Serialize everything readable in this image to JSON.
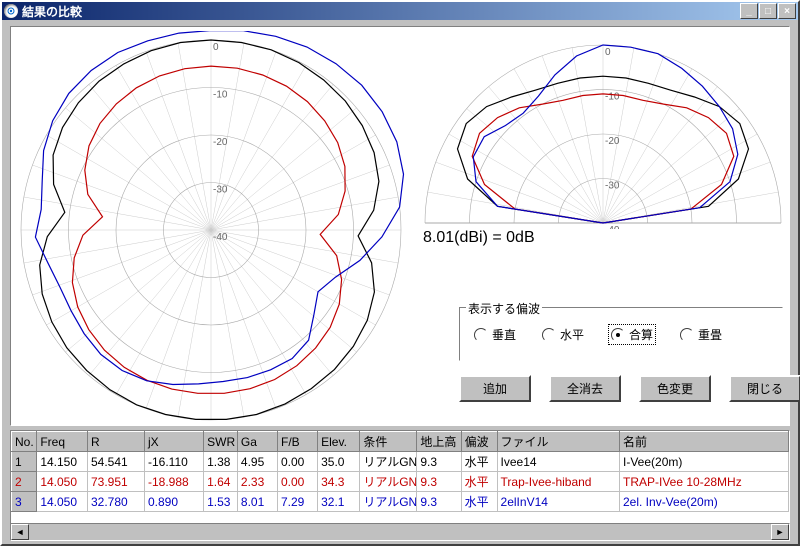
{
  "window": {
    "title": "結果の比較"
  },
  "chart_data": [
    {
      "type": "polar-azimuth",
      "rings": [
        0,
        -10,
        -20,
        -30,
        -40
      ],
      "angles_deg": {
        "start": 0,
        "end": 360,
        "step": 10
      },
      "zero_at": "top",
      "series": [
        {
          "name": "Ivee14",
          "color": "#000000",
          "r": [
            0,
            0,
            0,
            -0.2,
            -0.5,
            -0.8,
            -1.3,
            -2,
            -3.2,
            -5.5,
            -9,
            -5.5,
            -3.2,
            -2,
            -1.3,
            -0.8,
            -0.5,
            -0.2,
            0,
            0,
            0,
            0,
            0,
            -0.2,
            -0.5,
            -0.8,
            -1.3,
            -2,
            -3.2,
            -5.5,
            -9,
            -5.5,
            -3.2,
            -2,
            -1.3,
            -0.8,
            -0.5,
            -0.2,
            0,
            0
          ]
        },
        {
          "name": "Trap-Ivee-hiband",
          "color": "#c00000",
          "r": [
            -5.5,
            -5.5,
            -5.6,
            -5.8,
            -6.2,
            -6.8,
            -7.6,
            -8.8,
            -10.6,
            -13,
            -17,
            -13,
            -10.6,
            -8.8,
            -7.6,
            -6.8,
            -6.2,
            -5.8,
            -5.6,
            -5.5,
            -5.5,
            -5.5,
            -5.6,
            -5.8,
            -6.2,
            -6.8,
            -7.6,
            -8.8,
            -10.6,
            -13,
            -17,
            -13,
            -10.6,
            -8.8,
            -7.6,
            -6.8,
            -6.2,
            -5.8,
            -5.6,
            -5.5
          ]
        },
        {
          "name": "2elInV14",
          "color": "#0000c0",
          "r": [
            2,
            2.5,
            3,
            3.5,
            3.8,
            4,
            3.8,
            3.3,
            2.2,
            0,
            -4,
            -8,
            -12,
            -14,
            -12,
            -9,
            -8,
            -8,
            -8,
            -8,
            -7.5,
            -6.5,
            -5.5,
            -5,
            -5,
            -5.5,
            -6,
            -6,
            -5,
            -3,
            -4,
            -3,
            -1,
            0.5,
            1.5,
            2,
            2.2,
            2,
            2,
            2
          ]
        }
      ]
    },
    {
      "type": "polar-elevation",
      "rings": [
        0,
        -10,
        -20,
        -30,
        -40
      ],
      "angles_deg": {
        "start": 0,
        "end": 180,
        "step": 10
      },
      "zero_at": "top",
      "series": [
        {
          "name": "Ivee14",
          "color": "#000000",
          "r": [
            -40,
            -16,
            -8,
            -3.3,
            -2,
            -3,
            -5,
            -6.5,
            -7,
            -7,
            -7,
            -7,
            -7,
            -6.5,
            -5,
            -3,
            -2,
            -3.3,
            -8,
            -16,
            -40
          ]
        },
        {
          "name": "Trap-Ivee-hiband",
          "color": "#c00000",
          "r": [
            -40,
            -20,
            -12,
            -7,
            -5.7,
            -6.5,
            -8,
            -10,
            -11,
            -11,
            -11,
            -11,
            -11,
            -10,
            -8,
            -6.5,
            -5.7,
            -7,
            -12,
            -20,
            -40
          ]
        },
        {
          "name": "2elInV14",
          "color": "#0000c0",
          "r": [
            -40,
            -18,
            -10,
            -6,
            -4,
            -3,
            -2,
            -1,
            0,
            0,
            0,
            -2,
            -5,
            -8,
            -9.5,
            -9,
            -7,
            -7.3,
            -10,
            -16,
            -40
          ]
        }
      ],
      "label": "8.01(dBi) = 0dB"
    }
  ],
  "polarization": {
    "legend": "表示する偏波",
    "options": [
      "垂直",
      "水平",
      "合算",
      "重畳"
    ],
    "selected": 2
  },
  "buttons": {
    "add": "追加",
    "clear": "全消去",
    "color": "色変更",
    "close": "閉じる"
  },
  "table": {
    "headers": [
      "No.",
      "Freq",
      "R",
      "jX",
      "SWR",
      "Ga",
      "F/B",
      "Elev.",
      "条件",
      "地上高",
      "偏波",
      "ファイル",
      "名前"
    ],
    "rows": [
      {
        "no": "1",
        "freq": "14.150",
        "r": "54.541",
        "jx": "-16.110",
        "swr": "1.38",
        "ga": "4.95",
        "fb": "0.00",
        "elev": "35.0",
        "cond": "リアルGND",
        "hgt": "9.3",
        "pol": "水平",
        "file": "Ivee14",
        "name": "I-Vee(20m)"
      },
      {
        "no": "2",
        "freq": "14.050",
        "r": "73.951",
        "jx": "-18.988",
        "swr": "1.64",
        "ga": "2.33",
        "fb": "0.00",
        "elev": "34.3",
        "cond": "リアルGND",
        "hgt": "9.3",
        "pol": "水平",
        "file": "Trap-Ivee-hiband",
        "name": "TRAP-IVee 10-28MHz"
      },
      {
        "no": "3",
        "freq": "14.050",
        "r": "32.780",
        "jx": "0.890",
        "swr": "1.53",
        "ga": "8.01",
        "fb": "7.29",
        "elev": "32.1",
        "cond": "リアルGND",
        "hgt": "9.3",
        "pol": "水平",
        "file": "2elInV14",
        "name": "2el. Inv-Vee(20m)"
      }
    ]
  }
}
